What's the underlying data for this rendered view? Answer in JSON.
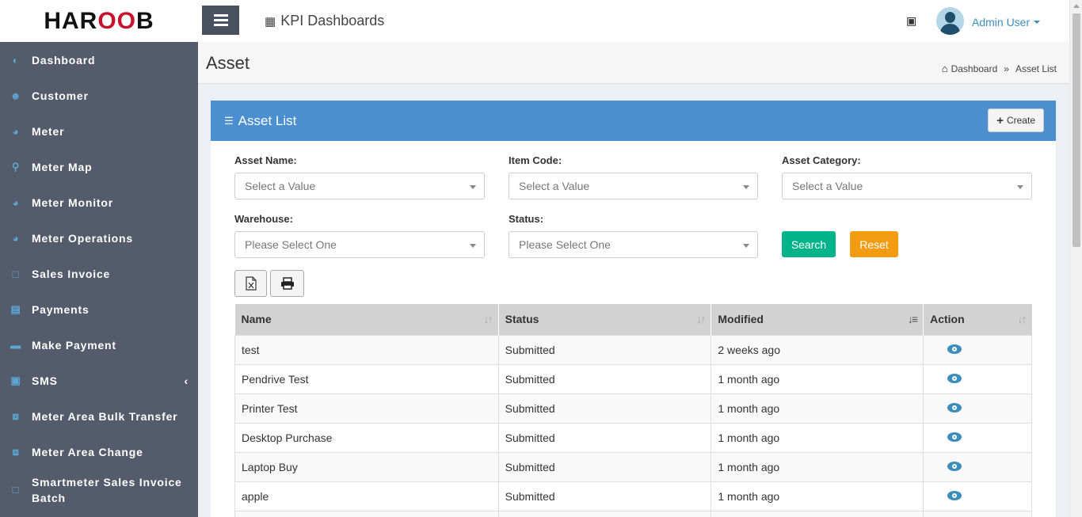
{
  "brand": {
    "logo_left": "HAR",
    "logo_mid": "OO",
    "logo_right": "B"
  },
  "topbar": {
    "app_title": "KPI Dashboards",
    "user_name": "Admin User"
  },
  "sidebar": {
    "items": [
      {
        "label": "Dashboard"
      },
      {
        "label": "Customer"
      },
      {
        "label": "Meter"
      },
      {
        "label": "Meter Map"
      },
      {
        "label": "Meter Monitor"
      },
      {
        "label": "Meter Operations"
      },
      {
        "label": "Sales Invoice"
      },
      {
        "label": "Payments"
      },
      {
        "label": "Make Payment"
      },
      {
        "label": "SMS"
      },
      {
        "label": "Meter Area Bulk Transfer"
      },
      {
        "label": "Meter Area Change"
      },
      {
        "label": "Smartmeter Sales Invoice Batch"
      }
    ]
  },
  "header": {
    "title": "Asset",
    "breadcrumb": {
      "home": "Dashboard",
      "separator": "»",
      "current": "Asset List"
    }
  },
  "box": {
    "title": "Asset List",
    "create_label": "Create",
    "filters": {
      "asset_name": {
        "label": "Asset Name:",
        "placeholder": "Select a Value"
      },
      "item_code": {
        "label": "Item Code:",
        "placeholder": "Select a Value"
      },
      "asset_category": {
        "label": "Asset Category:",
        "placeholder": "Select a Value"
      },
      "warehouse": {
        "label": "Warehouse:",
        "placeholder": "Please Select One"
      },
      "status": {
        "label": "Status:",
        "placeholder": "Please Select One"
      }
    },
    "search_label": "Search",
    "reset_label": "Reset"
  },
  "table": {
    "columns": [
      "Name",
      "Status",
      "Modified",
      "Action"
    ],
    "rows": [
      {
        "name": "test",
        "status": "Submitted",
        "modified": "2 weeks ago"
      },
      {
        "name": "Pendrive Test",
        "status": "Submitted",
        "modified": "1 month ago"
      },
      {
        "name": "Printer Test",
        "status": "Submitted",
        "modified": "1 month ago"
      },
      {
        "name": "Desktop Purchase",
        "status": "Submitted",
        "modified": "1 month ago"
      },
      {
        "name": "Laptop Buy",
        "status": "Submitted",
        "modified": "1 month ago"
      },
      {
        "name": "apple",
        "status": "Submitted",
        "modified": "1 month ago"
      },
      {
        "name": "",
        "status": "",
        "modified": ""
      }
    ]
  },
  "colors": {
    "sidebar": "#545c6b",
    "accent": "#4b8fd1",
    "search": "#00b38a",
    "reset": "#f39c12",
    "link": "#3c8dbc"
  }
}
